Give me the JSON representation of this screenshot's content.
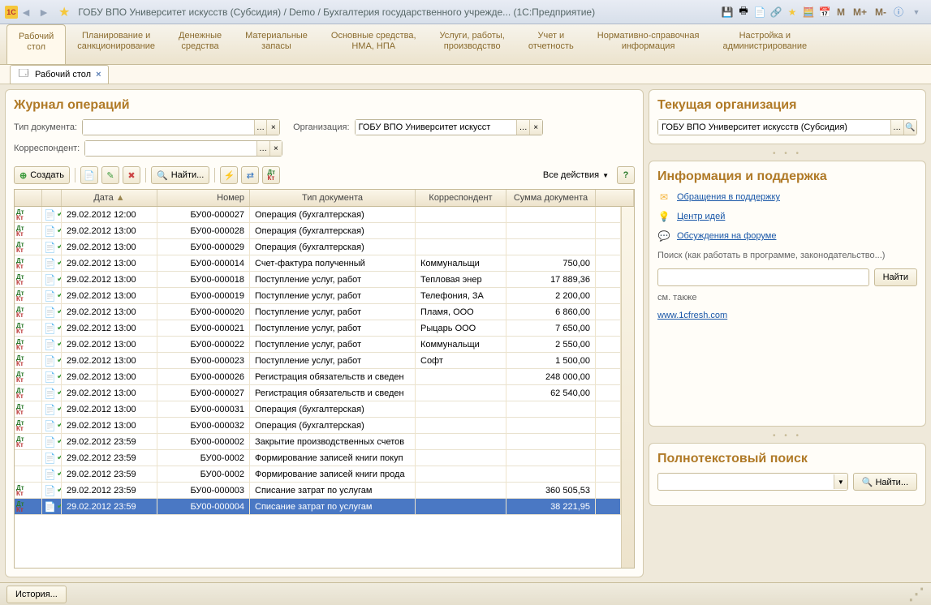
{
  "title": "ГОБУ ВПО Университет искусств (Субсидия) / Demo / Бухгалтерия государственного учрежде...   (1С:Предприятие)",
  "mainTabs": [
    {
      "l1": "Рабочий",
      "l2": "стол"
    },
    {
      "l1": "Планирование и",
      "l2": "санкционирование"
    },
    {
      "l1": "Денежные",
      "l2": "средства"
    },
    {
      "l1": "Материальные",
      "l2": "запасы"
    },
    {
      "l1": "Основные средства,",
      "l2": "НМА, НПА"
    },
    {
      "l1": "Услуги, работы,",
      "l2": "производство"
    },
    {
      "l1": "Учет и",
      "l2": "отчетность"
    },
    {
      "l1": "Нормативно-справочная",
      "l2": "информация"
    },
    {
      "l1": "Настройка и",
      "l2": "администрирование"
    }
  ],
  "subTab": "Рабочий стол",
  "journal": {
    "title": "Журнал операций",
    "doc_type_label": "Тип документа:",
    "org_label": "Организация:",
    "org_value": "ГОБУ ВПО Университет искусст",
    "korr_label": "Корреспондент:",
    "create_label": "Создать",
    "find_label": "Найти...",
    "all_actions": "Все действия",
    "columns": {
      "date": "Дата",
      "num": "Номер",
      "type": "Тип документа",
      "korr": "Корреспондент",
      "sum": "Сумма документа"
    },
    "rows": [
      {
        "dk": true,
        "date": "29.02.2012 12:00",
        "num": "БУ00-000027",
        "type": "Операция (бухгалтерская)",
        "korr": "",
        "sum": ""
      },
      {
        "dk": true,
        "date": "29.02.2012 13:00",
        "num": "БУ00-000028",
        "type": "Операция (бухгалтерская)",
        "korr": "",
        "sum": ""
      },
      {
        "dk": true,
        "date": "29.02.2012 13:00",
        "num": "БУ00-000029",
        "type": "Операция (бухгалтерская)",
        "korr": "",
        "sum": ""
      },
      {
        "dk": true,
        "date": "29.02.2012 13:00",
        "num": "БУ00-000014",
        "type": "Счет-фактура полученный",
        "korr": "Коммунальщи",
        "sum": "750,00"
      },
      {
        "dk": true,
        "date": "29.02.2012 13:00",
        "num": "БУ00-000018",
        "type": "Поступление услуг, работ",
        "korr": "Тепловая энер",
        "sum": "17 889,36"
      },
      {
        "dk": true,
        "date": "29.02.2012 13:00",
        "num": "БУ00-000019",
        "type": "Поступление услуг, работ",
        "korr": "Телефония, ЗА",
        "sum": "2 200,00"
      },
      {
        "dk": true,
        "date": "29.02.2012 13:00",
        "num": "БУ00-000020",
        "type": "Поступление услуг, работ",
        "korr": "Пламя, ООО",
        "sum": "6 860,00"
      },
      {
        "dk": true,
        "date": "29.02.2012 13:00",
        "num": "БУ00-000021",
        "type": "Поступление услуг, работ",
        "korr": "Рыцарь ООО",
        "sum": "7 650,00"
      },
      {
        "dk": true,
        "date": "29.02.2012 13:00",
        "num": "БУ00-000022",
        "type": "Поступление услуг, работ",
        "korr": "Коммунальщи",
        "sum": "2 550,00"
      },
      {
        "dk": true,
        "date": "29.02.2012 13:00",
        "num": "БУ00-000023",
        "type": "Поступление услуг, работ",
        "korr": "Софт",
        "sum": "1 500,00"
      },
      {
        "dk": true,
        "date": "29.02.2012 13:00",
        "num": "БУ00-000026",
        "type": "Регистрация обязательств и сведен",
        "korr": "",
        "sum": "248 000,00"
      },
      {
        "dk": true,
        "date": "29.02.2012 13:00",
        "num": "БУ00-000027",
        "type": "Регистрация обязательств и сведен",
        "korr": "",
        "sum": "62 540,00"
      },
      {
        "dk": true,
        "date": "29.02.2012 13:00",
        "num": "БУ00-000031",
        "type": "Операция (бухгалтерская)",
        "korr": "",
        "sum": ""
      },
      {
        "dk": true,
        "date": "29.02.2012 13:00",
        "num": "БУ00-000032",
        "type": "Операция (бухгалтерская)",
        "korr": "",
        "sum": ""
      },
      {
        "dk": true,
        "date": "29.02.2012 23:59",
        "num": "БУ00-000002",
        "type": "Закрытие производственных счетов",
        "korr": "",
        "sum": ""
      },
      {
        "dk": false,
        "date": "29.02.2012 23:59",
        "num": "БУ00-0002",
        "type": "Формирование записей книги покуп",
        "korr": "",
        "sum": ""
      },
      {
        "dk": false,
        "date": "29.02.2012 23:59",
        "num": "БУ00-0002",
        "type": "Формирование записей книги прода",
        "korr": "",
        "sum": ""
      },
      {
        "dk": true,
        "date": "29.02.2012 23:59",
        "num": "БУ00-000003",
        "type": "Списание затрат по услугам",
        "korr": "",
        "sum": "360 505,53"
      },
      {
        "dk": true,
        "date": "29.02.2012 23:59",
        "num": "БУ00-000004",
        "type": "Списание затрат по услугам",
        "korr": "",
        "sum": "38 221,95",
        "selected": true
      }
    ]
  },
  "right": {
    "current_org_title": "Текущая организация",
    "current_org_value": "ГОБУ ВПО Университет искусств (Субсидия)",
    "info_title": "Информация и поддержка",
    "support_link": "Обращения в поддержку",
    "ideas_link": "Центр идей",
    "forum_link": "Обсуждения на форуме",
    "search_label": "Поиск (как работать в программе, законодательство...)",
    "search_btn": "Найти",
    "see_also": "см. также",
    "fresh_link": "www.1cfresh.com",
    "ft_title": "Полнотекстовый поиск",
    "ft_btn": "Найти..."
  },
  "status": {
    "history": "История..."
  }
}
